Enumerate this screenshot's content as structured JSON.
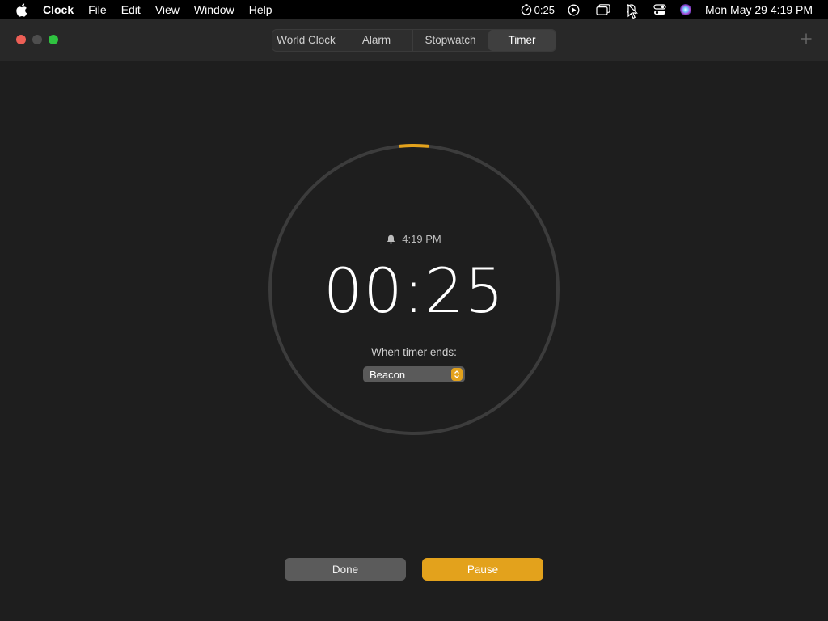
{
  "menubar": {
    "app_name": "Clock",
    "items": [
      "File",
      "Edit",
      "View",
      "Window",
      "Help"
    ],
    "status_timer": "0:25",
    "datetime": "Mon May 29  4:19 PM"
  },
  "tabs": [
    {
      "label": "World Clock",
      "active": false
    },
    {
      "label": "Alarm",
      "active": false
    },
    {
      "label": "Stopwatch",
      "active": false
    },
    {
      "label": "Timer",
      "active": true
    }
  ],
  "timer": {
    "alarm_time": "4:19 PM",
    "remaining": "00:25",
    "when_ends_label": "When timer ends:",
    "sound": "Beacon",
    "done_label": "Done",
    "pause_label": "Pause",
    "progress_remaining": 0.03
  },
  "colors": {
    "accent": "#e3a21c",
    "ring": "#3c3c3c",
    "background": "#1e1e1e"
  },
  "icons": [
    "apple-icon",
    "timer-icon",
    "play-icon",
    "screens-icon",
    "notification-icon",
    "control-center-icon",
    "siri-icon",
    "bell-icon",
    "add-icon"
  ]
}
